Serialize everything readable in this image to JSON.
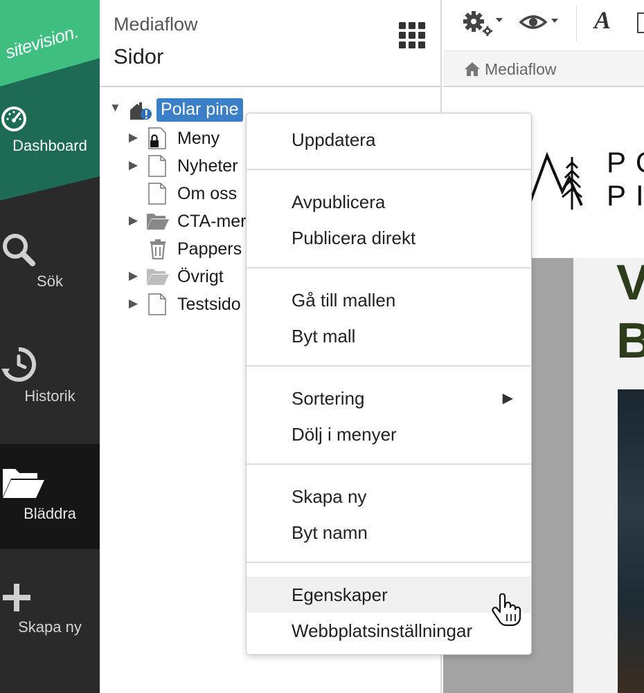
{
  "brand": {
    "logo_text": "sitevision."
  },
  "rail": {
    "items": [
      {
        "label": "Dashboard",
        "icon": "speedometer-icon"
      },
      {
        "label": "Sök",
        "icon": "search-icon"
      },
      {
        "label": "Historik",
        "icon": "history-icon"
      },
      {
        "label": "Bläddra",
        "icon": "folder-open-icon"
      },
      {
        "label": "Skapa ny",
        "icon": "plus-icon"
      }
    ]
  },
  "sidepanel": {
    "site_name": "Mediaflow",
    "title": "Sidor"
  },
  "tree": {
    "root": {
      "label": "Polar pine",
      "selected": true,
      "expanded": true
    },
    "children": [
      {
        "label": "Meny",
        "icon": "locked-page-icon",
        "expandable": true
      },
      {
        "label": "Nyheter",
        "icon": "page-icon",
        "expandable": true
      },
      {
        "label": "Om oss",
        "icon": "page-icon",
        "expandable": false
      },
      {
        "label": "CTA-mer",
        "icon": "folder-icon",
        "expandable": true
      },
      {
        "label": "Pappers",
        "icon": "trash-icon",
        "expandable": false
      },
      {
        "label": "Övrigt",
        "icon": "folder-light-icon",
        "expandable": true
      },
      {
        "label": "Testsido",
        "icon": "page-icon",
        "expandable": true
      }
    ]
  },
  "toolbar": {
    "icons": [
      "gear-dropdown-icon",
      "eye-dropdown-icon",
      "font-icon"
    ]
  },
  "breadcrumb": {
    "label": "Mediaflow"
  },
  "preview": {
    "logo_text": "PO\nPI",
    "heading": "V\nB"
  },
  "context_menu": {
    "items": [
      {
        "label": "Uppdatera"
      },
      {
        "label": "Avpublicera"
      },
      {
        "label": "Publicera direkt"
      },
      {
        "label": "Gå till mallen"
      },
      {
        "label": "Byt mall"
      },
      {
        "label": "Sortering",
        "submenu": true
      },
      {
        "label": "Dölj i menyer"
      },
      {
        "label": "Skapa ny"
      },
      {
        "label": "Byt namn"
      },
      {
        "label": "Egenskaper",
        "hovered": true
      },
      {
        "label": "Webbplatsinställningar"
      }
    ]
  },
  "colors": {
    "brand_green": "#3fbf7f",
    "dark_green": "#1d6b55",
    "rail_bg": "#2a2a2a",
    "selection_blue": "#3a7fc8"
  }
}
